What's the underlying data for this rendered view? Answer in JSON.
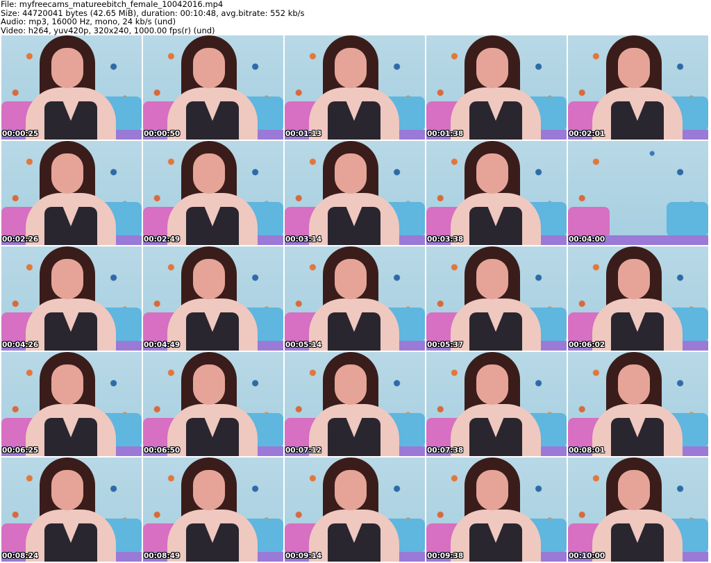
{
  "header": {
    "file": "File: myfreecams_matureebitch_female_10042016.mp4",
    "size": "Size: 44720041 bytes (42.65 MiB), duration: 00:10:48, avg.bitrate: 552 kb/s",
    "audio": "Audio: mp3, 16000 Hz, mono, 24 kb/s (und)",
    "video": "Video: h264, yuv420p, 320x240, 1000.00 fps(r) (und)"
  },
  "thumbnails": [
    "00:00:25",
    "00:00:50",
    "00:01:13",
    "00:01:38",
    "00:02:01",
    "00:02:26",
    "00:02:49",
    "00:03:14",
    "00:03:38",
    "00:04:00",
    "00:04:26",
    "00:04:49",
    "00:05:14",
    "00:05:37",
    "00:06:02",
    "00:06:25",
    "00:06:50",
    "00:07:12",
    "00:07:38",
    "00:08:01",
    "00:08:24",
    "00:08:49",
    "00:09:14",
    "00:09:38",
    "00:10:00"
  ]
}
